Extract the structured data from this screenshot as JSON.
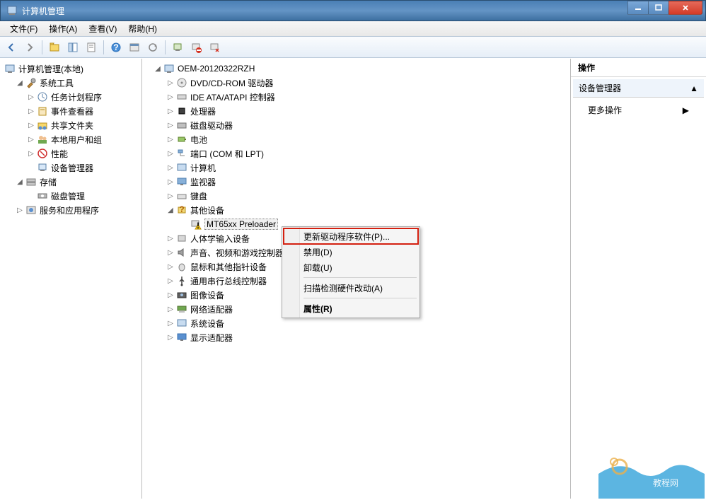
{
  "window": {
    "title": "计算机管理"
  },
  "menu": {
    "file": "文件(F)",
    "action": "操作(A)",
    "view": "查看(V)",
    "help": "帮助(H)"
  },
  "left_tree": {
    "root": "计算机管理(本地)",
    "system_tools": "系统工具",
    "task_scheduler": "任务计划程序",
    "event_viewer": "事件查看器",
    "shared_folders": "共享文件夹",
    "local_users": "本地用户和组",
    "performance": "性能",
    "device_manager": "设备管理器",
    "storage": "存储",
    "disk_management": "磁盘管理",
    "services_apps": "服务和应用程序"
  },
  "center_tree": {
    "root": "OEM-20120322RZH",
    "dvd": "DVD/CD-ROM 驱动器",
    "ide": "IDE ATA/ATAPI 控制器",
    "cpu": "处理器",
    "disk": "磁盘驱动器",
    "battery": "电池",
    "ports": "端口 (COM 和 LPT)",
    "computer": "计算机",
    "monitor": "监视器",
    "keyboard": "键盘",
    "other": "其他设备",
    "preloader": "MT65xx Preloader",
    "hid": "人体学输入设备",
    "sound": "声音、视频和游戏控制器",
    "mouse": "鼠标和其他指针设备",
    "usb": "通用串行总线控制器",
    "imaging": "图像设备",
    "network": "网络适配器",
    "system": "系统设备",
    "display": "显示适配器"
  },
  "ctx": {
    "update": "更新驱动程序软件(P)...",
    "disable": "禁用(D)",
    "uninstall": "卸载(U)",
    "scan": "扫描检测硬件改动(A)",
    "properties": "属性(R)"
  },
  "right": {
    "header": "操作",
    "sub": "设备管理器",
    "more": "更多操作"
  }
}
